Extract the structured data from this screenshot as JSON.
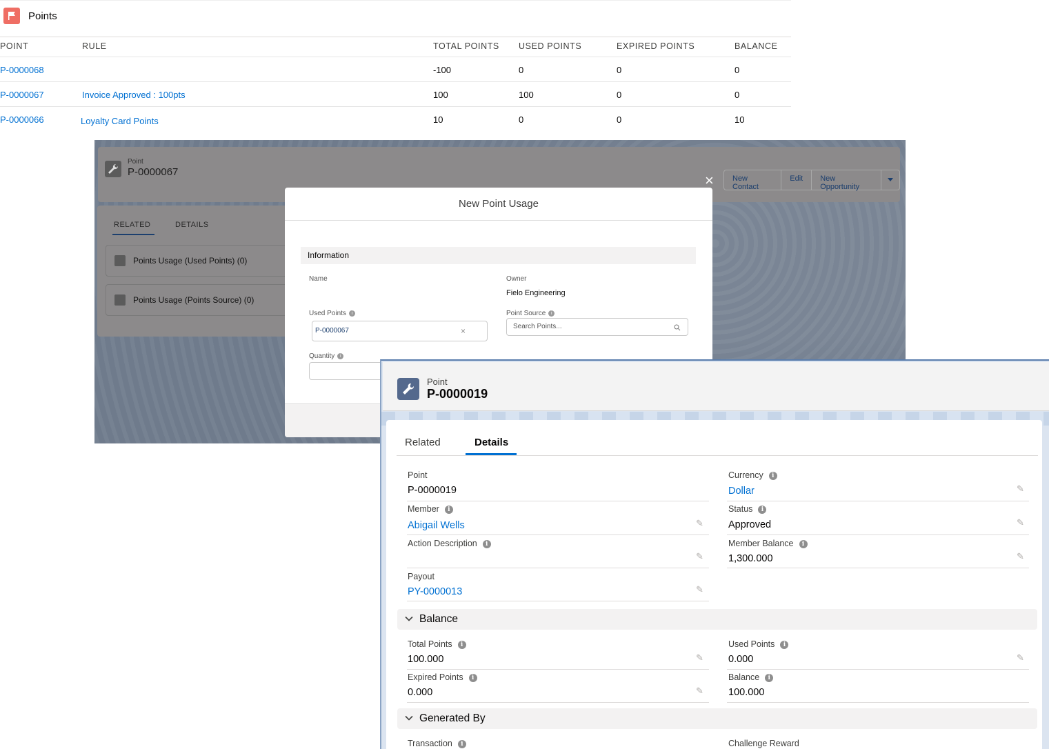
{
  "points_list": {
    "title": "Points",
    "columns": [
      "POINT",
      "RULE",
      "TOTAL POINTS",
      "USED POINTS",
      "EXPIRED POINTS",
      "BALANCE"
    ],
    "rows": [
      {
        "point": "P-0000068",
        "rule": "",
        "total": "-100",
        "used": "0",
        "expired": "0",
        "balance": "0"
      },
      {
        "point": "P-0000067",
        "rule": "Invoice  Approved : 100pts",
        "total": "100",
        "used": "100",
        "expired": "0",
        "balance": "0"
      },
      {
        "point": "P-0000066",
        "rule": "Loyalty Card Points",
        "total": "10",
        "used": "0",
        "expired": "0",
        "balance": "10"
      }
    ]
  },
  "bg_record": {
    "type": "Point",
    "name": "P-0000067",
    "close_glyph": "×",
    "actions": [
      "New Contact",
      "Edit",
      "New Opportunity"
    ],
    "tabs": [
      "RELATED",
      "DETAILS"
    ],
    "related_cards": [
      "Points Usage (Used Points) (0)",
      "Points Usage (Points Source) (0)"
    ]
  },
  "modal": {
    "title": "New Point Usage",
    "section": "Information",
    "name_label": "Name",
    "owner_label": "Owner",
    "owner_value": "Fielo Engineering",
    "used_points_label": "Used Points",
    "used_points_value": "P-0000067",
    "point_source_label": "Point Source",
    "point_source_placeholder": "Search Points...",
    "quantity_label": "Quantity"
  },
  "record": {
    "type": "Point",
    "name": "P-0000019",
    "tabs": {
      "related": "Related",
      "details": "Details"
    },
    "fields": {
      "point_label": "Point",
      "point_value": "P-0000019",
      "currency_label": "Currency",
      "currency_value": "Dollar",
      "member_label": "Member",
      "member_value": "Abigail Wells",
      "status_label": "Status",
      "status_value": "Approved",
      "action_desc_label": "Action Description",
      "action_desc_value": "",
      "member_balance_label": "Member Balance",
      "member_balance_value": "1,300.000",
      "payout_label": "Payout",
      "payout_value": "PY-0000013"
    },
    "balance_section": {
      "title": "Balance",
      "total_label": "Total Points",
      "total_value": "100.000",
      "used_label": "Used Points",
      "used_value": "0.000",
      "expired_label": "Expired Points",
      "expired_value": "0.000",
      "balance_label": "Balance",
      "balance_value": "100.000"
    },
    "generated_section": {
      "title": "Generated By",
      "transaction_label": "Transaction",
      "challenge_reward_label": "Challenge Reward"
    }
  },
  "colors": {
    "link": "#0070d2",
    "flag_icon": "#ef6e64",
    "record_icon": "#54698d"
  }
}
